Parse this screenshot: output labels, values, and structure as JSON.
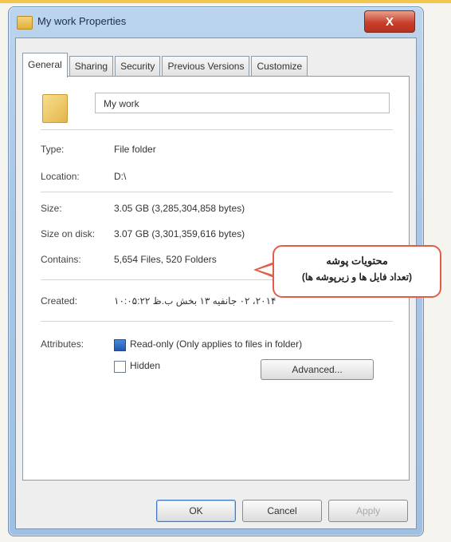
{
  "window": {
    "title": "My work Properties",
    "close_label": "X"
  },
  "tabs": [
    {
      "label": "General"
    },
    {
      "label": "Sharing"
    },
    {
      "label": "Security"
    },
    {
      "label": "Previous Versions"
    },
    {
      "label": "Customize"
    }
  ],
  "general": {
    "folder_name": "My work",
    "type_label": "Type:",
    "type_value": "File folder",
    "location_label": "Location:",
    "location_value": "D:\\",
    "size_label": "Size:",
    "size_value": "3.05 GB (3,285,304,858 bytes)",
    "size_on_disk_label": "Size on disk:",
    "size_on_disk_value": "3.07 GB (3,301,359,616 bytes)",
    "contains_label": "Contains:",
    "contains_value": "5,654 Files, 520 Folders",
    "created_label": "Created:",
    "created_value": "۲۰۱۴، ۰۲ جانفیه ۱۳ بخش ب.ظ ۱۰:۰۵:۲۲",
    "attributes_label": "Attributes:",
    "readonly_label": "Read-only (Only applies to files in folder)",
    "readonly_checked": true,
    "hidden_label": "Hidden",
    "hidden_checked": false,
    "advanced_label": "Advanced..."
  },
  "buttons": {
    "ok": "OK",
    "cancel": "Cancel",
    "apply": "Apply"
  },
  "callout": {
    "line1": "محتویات پوشه",
    "line2": "(تعداد فایل ها و زیرپوشه ها)"
  },
  "colors": {
    "titlebar": "#a9c6e6",
    "close_button": "#c9402c",
    "callout_border": "#e35c4a",
    "checkbox_checked": "#1d58b3"
  }
}
